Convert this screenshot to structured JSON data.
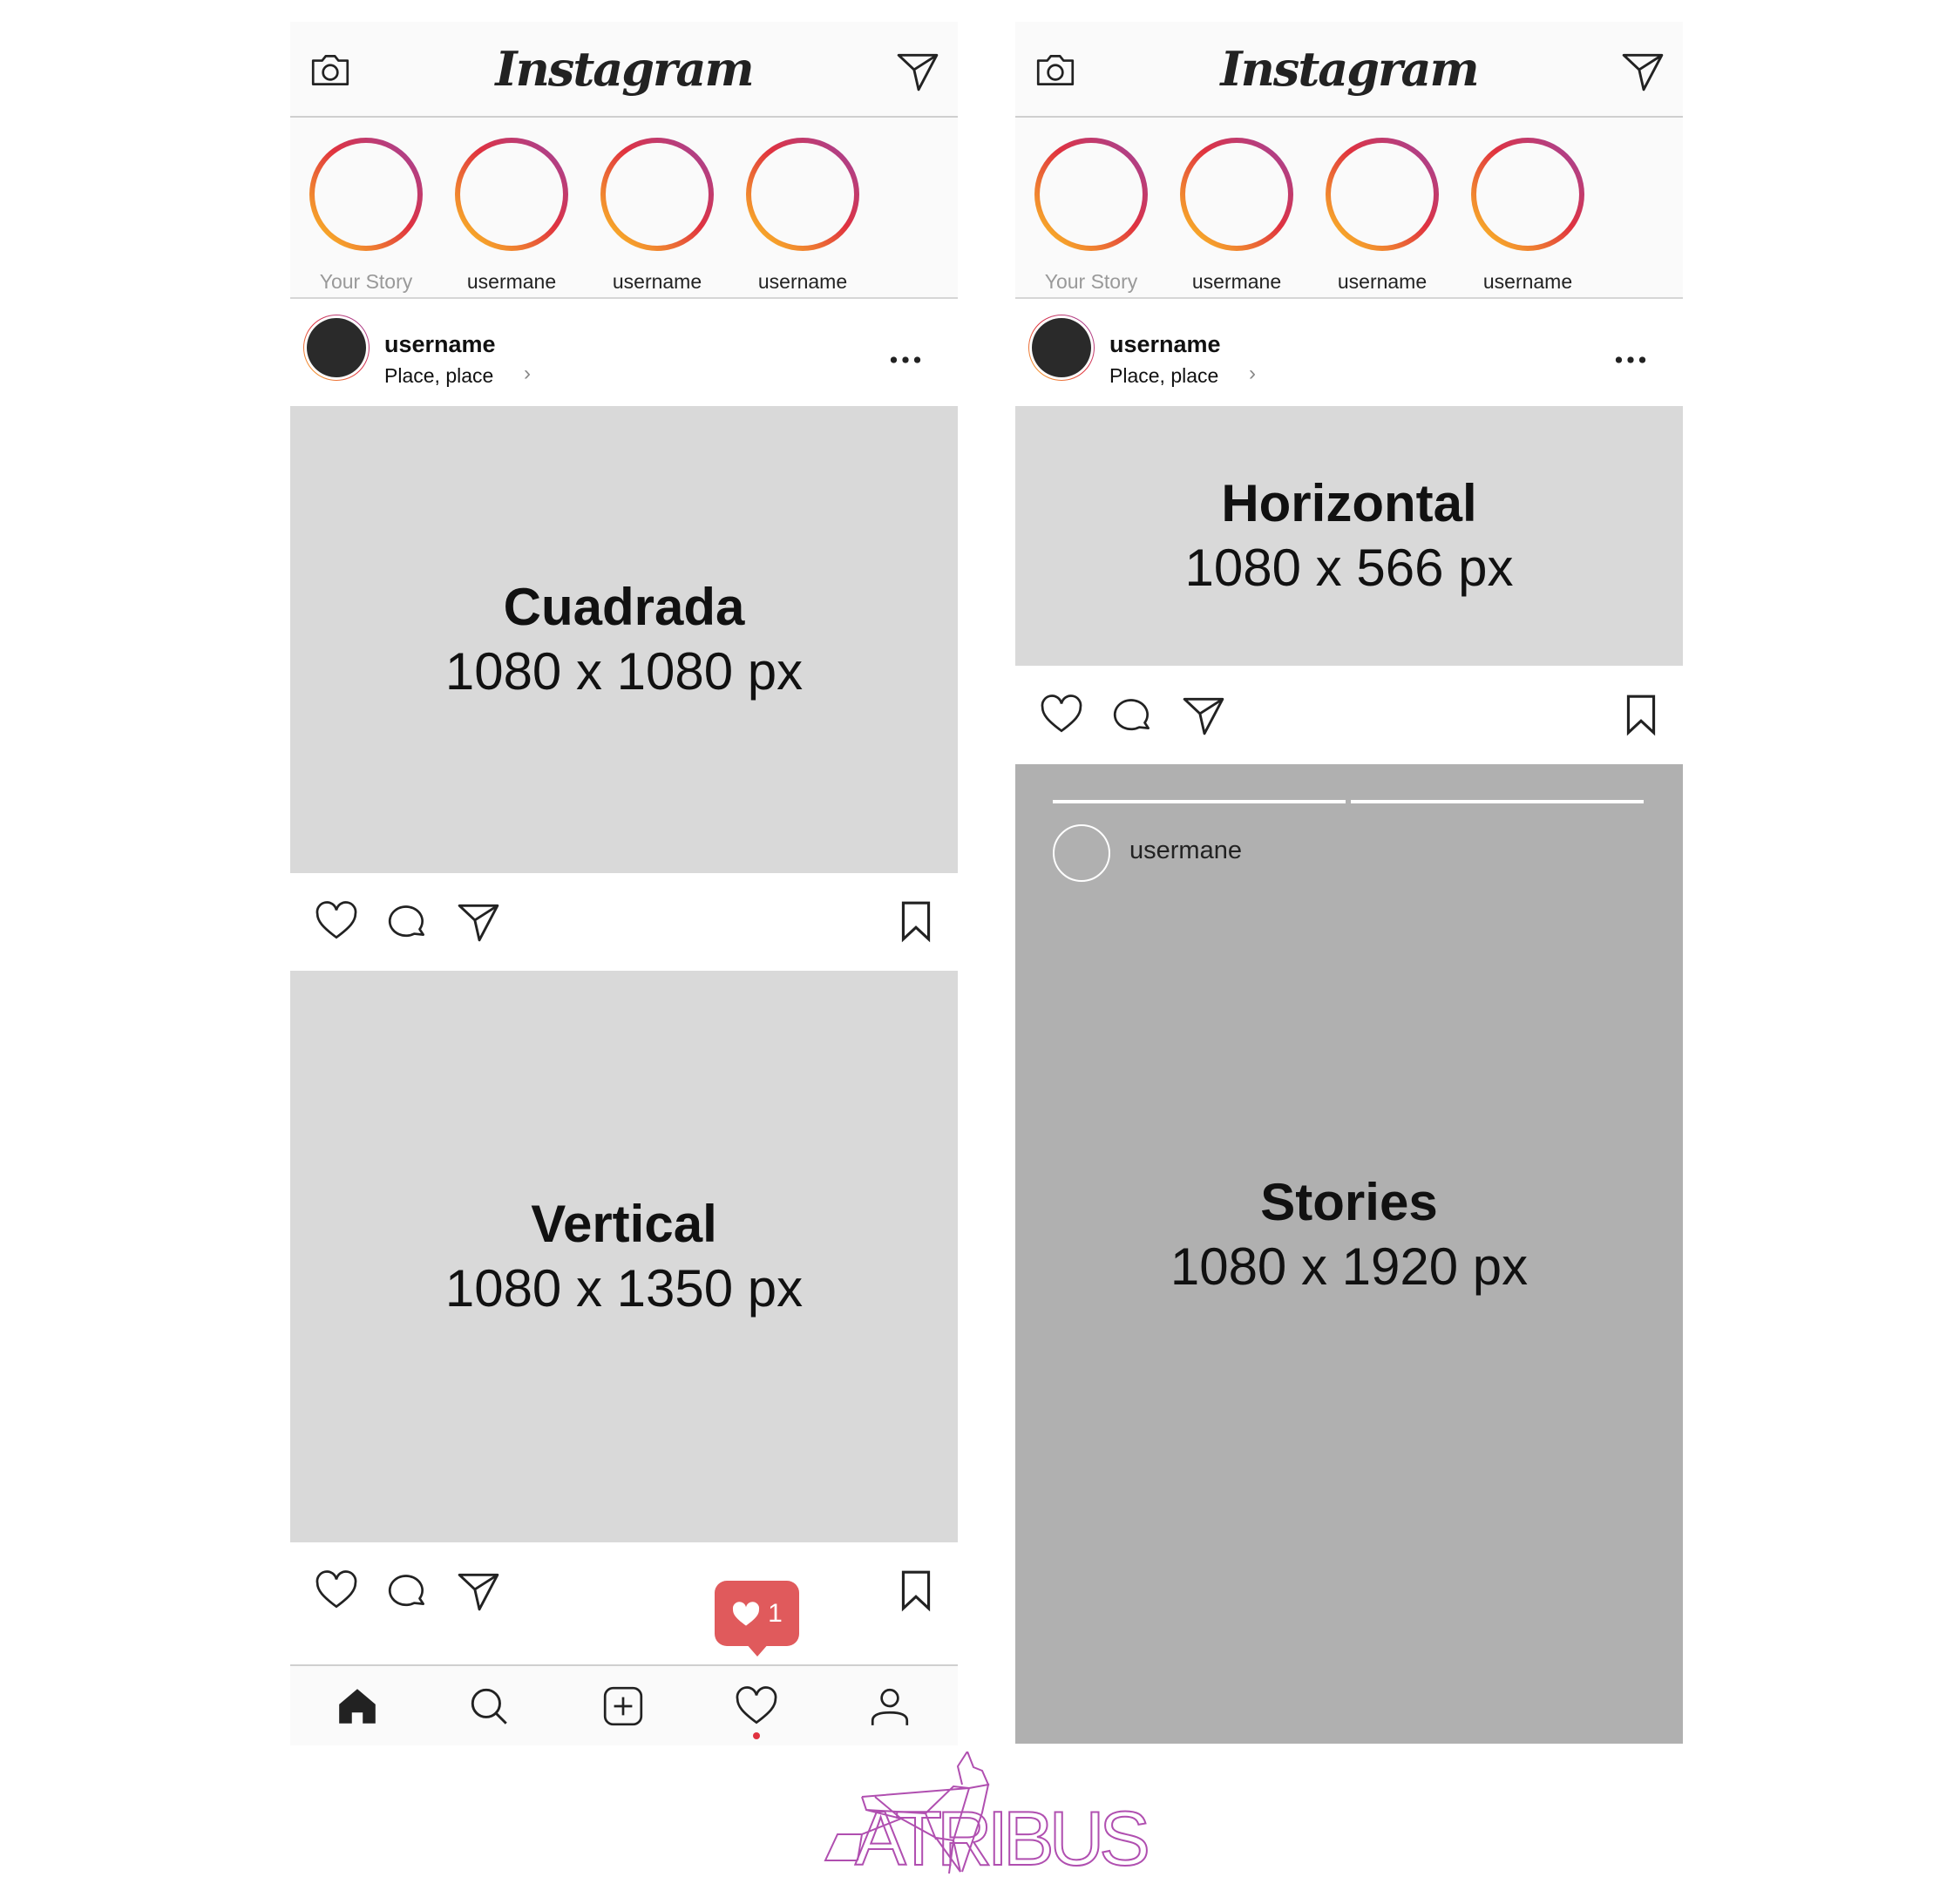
{
  "app": {
    "title": "Instagram"
  },
  "stories": [
    {
      "label": "Your Story",
      "own": true
    },
    {
      "label": "usermane"
    },
    {
      "label": "username"
    },
    {
      "label": "username"
    }
  ],
  "post_header": {
    "username": "username",
    "location": "Place, place"
  },
  "posts": {
    "square": {
      "title": "Cuadrada",
      "size": "1080 x 1080 px"
    },
    "vertical": {
      "title": "Vertical",
      "size": "1080 x 1350 px"
    },
    "horizontal": {
      "title": "Horizontal",
      "size": "1080 x 566 px"
    },
    "stories": {
      "title": "Stories",
      "size": "1080 x 1920 px",
      "username": "usermane",
      "progress_segments": 2
    }
  },
  "notification": {
    "icon": "heart-icon",
    "count": "1",
    "color": "#e05a5c"
  },
  "nav": [
    "home-icon",
    "search-icon",
    "add-icon",
    "heart-icon",
    "profile-icon"
  ],
  "colors": {
    "story_ring": [
      "#9a46a8",
      "#e0323f",
      "#f9b52b"
    ],
    "image_placeholder": "#d9d9d9",
    "story_bg": "#b0b0b0",
    "logo": "#b04fb0"
  },
  "brand": {
    "logo_text": "ATRIBUS"
  }
}
